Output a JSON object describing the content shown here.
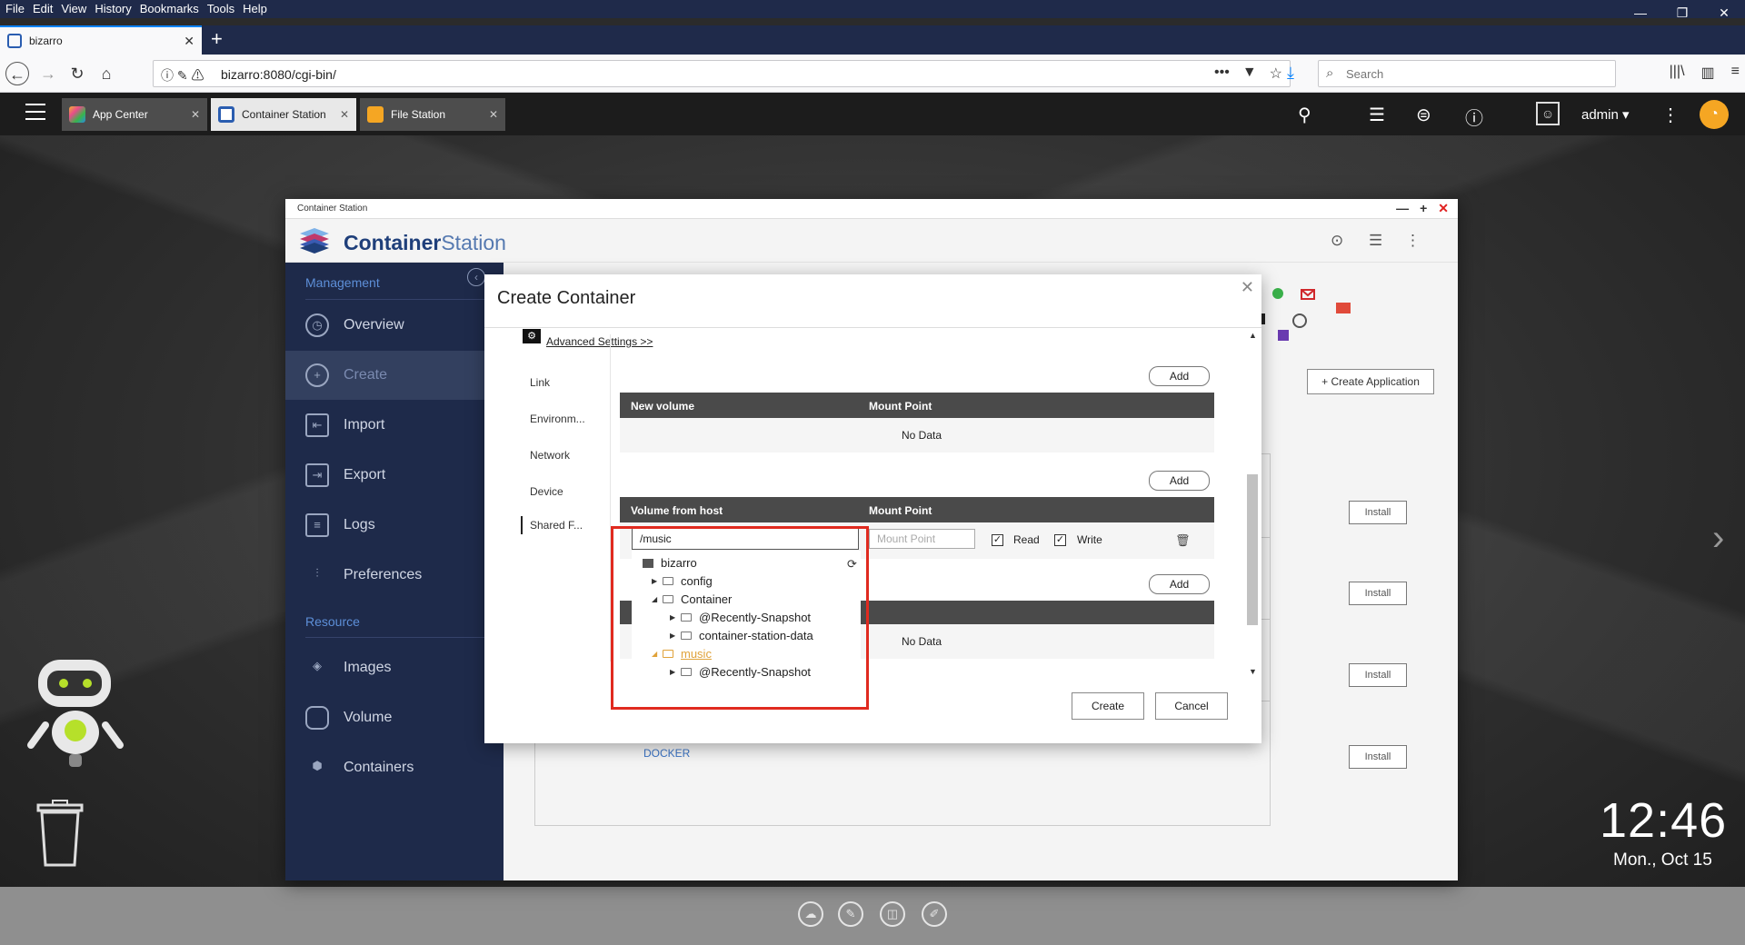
{
  "browser": {
    "menu": [
      "File",
      "Edit",
      "View",
      "History",
      "Bookmarks",
      "Tools",
      "Help"
    ],
    "tab_title": "bizarro",
    "url": "bizarro:8080/cgi-bin/",
    "search_placeholder": "Search"
  },
  "qts": {
    "tabs": [
      {
        "label": "App Center",
        "color": "#f2b233"
      },
      {
        "label": "Container Station",
        "color": "#2a5db0"
      },
      {
        "label": "File Station",
        "color": "#f5a623"
      }
    ],
    "user": "admin",
    "clock": "12:46",
    "date": "Mon., Oct 15"
  },
  "cs": {
    "window_title": "Container Station",
    "brand_bold": "Container",
    "brand_light": "Station",
    "sections": {
      "management": "Management",
      "resource": "Resource"
    },
    "nav": [
      {
        "label": "Overview",
        "icon": "gauge-icon"
      },
      {
        "label": "Create",
        "icon": "plus-circle-icon"
      },
      {
        "label": "Import",
        "icon": "import-icon"
      },
      {
        "label": "Export",
        "icon": "export-icon"
      },
      {
        "label": "Logs",
        "icon": "document-icon"
      },
      {
        "label": "Preferences",
        "icon": "sliders-icon"
      },
      {
        "label": "Images",
        "icon": "layers-icon"
      },
      {
        "label": "Volume",
        "icon": "cylinder-icon"
      },
      {
        "label": "Containers",
        "icon": "cube-icon"
      }
    ],
    "create_application": "Create Application",
    "install": "Install",
    "docker": "DOCKER"
  },
  "dialog": {
    "title": "Create Container",
    "advanced": "Advanced Settings >>",
    "tabs": [
      "Link",
      "Environm...",
      "Network",
      "Device",
      "Shared F..."
    ],
    "add": "Add",
    "new_volume_header": "New volume",
    "mount_point_header": "Mount Point",
    "no_data": "No Data",
    "volume_from_host_header": "Volume from host",
    "path_value": "/music",
    "mount_placeholder": "Mount Point",
    "read_label": "Read",
    "write_label": "Write",
    "tree": [
      {
        "label": "bizarro",
        "level": 0,
        "type": "server"
      },
      {
        "label": "config",
        "level": 1,
        "expanded": false
      },
      {
        "label": "Container",
        "level": 1,
        "expanded": true
      },
      {
        "label": "@Recently-Snapshot",
        "level": 2,
        "expanded": false
      },
      {
        "label": "container-station-data",
        "level": 2,
        "expanded": false
      },
      {
        "label": "music",
        "level": 1,
        "expanded": true,
        "selected": true
      },
      {
        "label": "@Recently-Snapshot",
        "level": 2,
        "expanded": false
      }
    ],
    "create": "Create",
    "cancel": "Cancel"
  }
}
